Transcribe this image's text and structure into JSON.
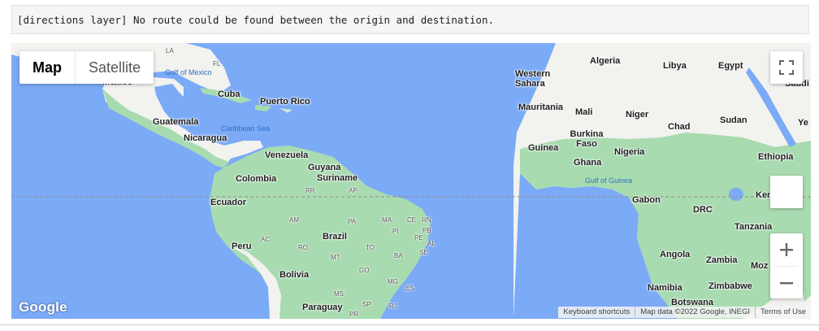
{
  "message": "[directions layer] No route could be found between the origin and destination.",
  "map": {
    "type_controls": {
      "map": "Map",
      "satellite": "Satellite"
    },
    "zoom_in_label": "+",
    "zoom_out_label": "−",
    "logo": "Google",
    "attribution": {
      "shortcuts": "Keyboard shortcuts",
      "data": "Map data ©2022 Google, INEGI",
      "terms": "Terms of Use"
    },
    "labels": {
      "countries": [
        "Mexico",
        "Cuba",
        "Puerto Rico",
        "Guatemala",
        "Nicaragua",
        "Venezuela",
        "Colombia",
        "Guyana",
        "Suriname",
        "Ecuador",
        "Peru",
        "Brazil",
        "Bolivia",
        "Paraguay",
        "Algeria",
        "Libya",
        "Egypt",
        "Western Sahara",
        "Mauritania",
        "Mali",
        "Niger",
        "Chad",
        "Sudan",
        "Burkina Faso",
        "Guinea",
        "Nigeria",
        "Ghana",
        "Ethiopia",
        "Gabon",
        "DRC",
        "Kenya",
        "Tanzania",
        "Angola",
        "Zambia",
        "Namibia",
        "Zimbabwe",
        "Botswana",
        "Saudi Ar",
        "Moz",
        "Ye"
      ],
      "water": [
        "Gulf of Mexico",
        "Caribbean Sea",
        "Gulf of Guinea"
      ],
      "states": [
        "LA",
        "FL",
        "RR",
        "AP",
        "AM",
        "PA",
        "MA",
        "CE",
        "RN",
        "PB",
        "PE",
        "AL",
        "SE",
        "PI",
        "TO",
        "BA",
        "AC",
        "RO",
        "MT",
        "GO",
        "MG",
        "ES",
        "MS",
        "SP",
        "RJ",
        "PR"
      ]
    }
  },
  "colors": {
    "water": "#7baaf7",
    "land": "#f2f2ef",
    "vegetation": "#a8dbb0",
    "equator": "#9a8d80"
  }
}
